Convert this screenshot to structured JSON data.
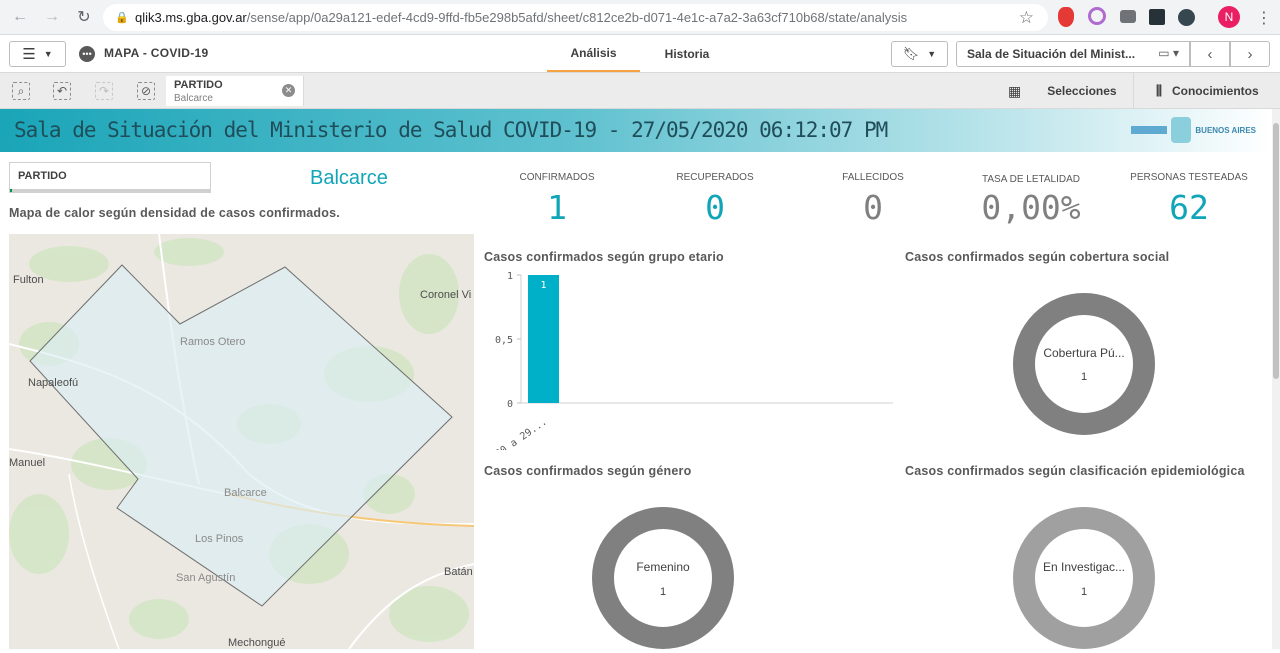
{
  "browser": {
    "url_host": "qlik3.ms.gba.gov.ar",
    "url_path": "/sense/app/0a29a121-edef-4cd9-9ffd-fb5e298b5afd/sheet/c812ce2b-d071-4e1c-a7a2-3a63cf710b68/state/analysis",
    "profile_initial": "N"
  },
  "toolbar": {
    "app_title": "MAPA - COVID-19",
    "tabs": [
      {
        "label": "Análisis"
      },
      {
        "label": "Historia"
      }
    ],
    "sheet_name": "Sala de Situación del Minist..."
  },
  "selection_bar": {
    "chip_field": "PARTIDO",
    "chip_value": "Balcarce",
    "selections_label": "Selecciones",
    "insights_label": "Conocimientos"
  },
  "banner": {
    "title": "Sala de Situación del Ministerio de Salud COVID-19 - 27/05/2020 06:12:07 PM",
    "logo_text": "BUENOS AIRES"
  },
  "filter": {
    "label": "PARTIDO",
    "selected_value": "Balcarce"
  },
  "map": {
    "caption": "Mapa de calor según densidad de casos confirmados.",
    "places": [
      "Fulton",
      "Coronel Vi",
      "Ramos Otero",
      "Napaleofú",
      "Manuel",
      "Balcarce",
      "Los Pinos",
      "San Agustín",
      "Batán",
      "Mechongué"
    ]
  },
  "kpis": [
    {
      "label": "CONFIRMADOS",
      "value": "1",
      "color": "#11a5b8"
    },
    {
      "label": "RECUPERADOS",
      "value": "0",
      "color": "#11a5b8"
    },
    {
      "label": "FALLECIDOS",
      "value": "0",
      "color": "#808080"
    },
    {
      "label": "TASA DE LETALIDAD",
      "value": "0,00%",
      "color": "#808080"
    },
    {
      "label": "PERSONAS TESTEADAS",
      "value": "62",
      "color": "#11a5b8"
    }
  ],
  "charts": {
    "age_title": "Casos confirmados según grupo etario",
    "coverage_title": "Casos confirmados según cobertura social",
    "gender_title": "Casos confirmados según género",
    "epi_title": "Casos confirmados según clasificación epidemiológica"
  },
  "chart_data": [
    {
      "type": "bar",
      "title": "Casos confirmados según grupo etario",
      "categories": [
        "20 a 29..."
      ],
      "values": [
        1
      ],
      "y_ticks": [
        "0",
        "0,5",
        "1"
      ],
      "ylim": [
        0,
        1
      ],
      "bar_color": "#00b0c8"
    },
    {
      "type": "pie",
      "title": "Casos confirmados según cobertura social",
      "labels": [
        "Cobertura Pú..."
      ],
      "values": [
        1
      ]
    },
    {
      "type": "pie",
      "title": "Casos confirmados según género",
      "labels": [
        "Femenino"
      ],
      "values": [
        1
      ]
    },
    {
      "type": "pie",
      "title": "Casos confirmados según clasificación epidemiológica",
      "labels": [
        "En Investigac..."
      ],
      "values": [
        1
      ]
    }
  ]
}
